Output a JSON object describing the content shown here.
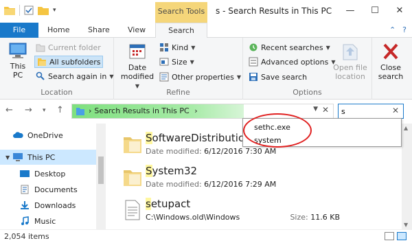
{
  "window": {
    "title": "s - Search Results in This PC",
    "context_tab_label": "Search Tools",
    "minimize": "—",
    "maximize": "☐",
    "close": "✕"
  },
  "ribbon_tabs": [
    "File",
    "Home",
    "Share",
    "View",
    "Search"
  ],
  "ribbon_tab_active": "Search",
  "ribbon": {
    "location": {
      "label": "Location",
      "this_pc_line1": "This",
      "this_pc_line2": "PC",
      "current_folder": "Current folder",
      "all_subfolders": "All subfolders",
      "search_again_in": "Search again in"
    },
    "refine": {
      "label": "Refine",
      "date_modified_line1": "Date",
      "date_modified_line2": "modified",
      "kind": "Kind",
      "size": "Size",
      "other_properties": "Other properties"
    },
    "options": {
      "label": "Options",
      "recent_searches": "Recent searches",
      "advanced_options": "Advanced options",
      "save_search": "Save search",
      "open_file_location_line1": "Open file",
      "open_file_location_line2": "location"
    },
    "close_search_line1": "Close",
    "close_search_line2": "search"
  },
  "address": {
    "path": "Search Results in This PC",
    "separator": "›"
  },
  "search": {
    "value": "s",
    "clear": "✕"
  },
  "suggestions": [
    "sethc.exe",
    "system"
  ],
  "nav_pane": {
    "items": [
      {
        "label": "OneDrive",
        "icon": "cloud-icon"
      },
      {
        "label": "This PC",
        "icon": "computer-icon",
        "selected": true
      },
      {
        "label": "Desktop",
        "icon": "desktop-folder-icon"
      },
      {
        "label": "Documents",
        "icon": "documents-folder-icon"
      },
      {
        "label": "Downloads",
        "icon": "downloads-folder-icon"
      },
      {
        "label": "Music",
        "icon": "music-folder-icon"
      }
    ]
  },
  "files": [
    {
      "highlight": "S",
      "rest": "oftwareDistribution",
      "meta_label": "Date modified:",
      "meta_value": "6/12/2016 7:30 AM",
      "icon": "folder-icon"
    },
    {
      "highlight": "S",
      "rest": "ystem32",
      "meta_label": "Date modified:",
      "meta_value": "6/12/2016 7:29 AM",
      "icon": "folder-icon"
    },
    {
      "highlight": "s",
      "rest": "etupact",
      "meta_label": "",
      "meta_value": "C:\\Windows.old\\Windows",
      "size_label": "Size:",
      "size_value": "11.6 KB",
      "icon": "text-file-icon"
    }
  ],
  "status": {
    "item_count": "2,054 items"
  },
  "colors": {
    "file_tab": "#1979ca",
    "search_tools": "#f5d67a",
    "address_progress": "#7ee07e",
    "highlight": "#fff7a0",
    "annotation_circle": "#e02020",
    "selected_nav": "#cce8ff"
  }
}
